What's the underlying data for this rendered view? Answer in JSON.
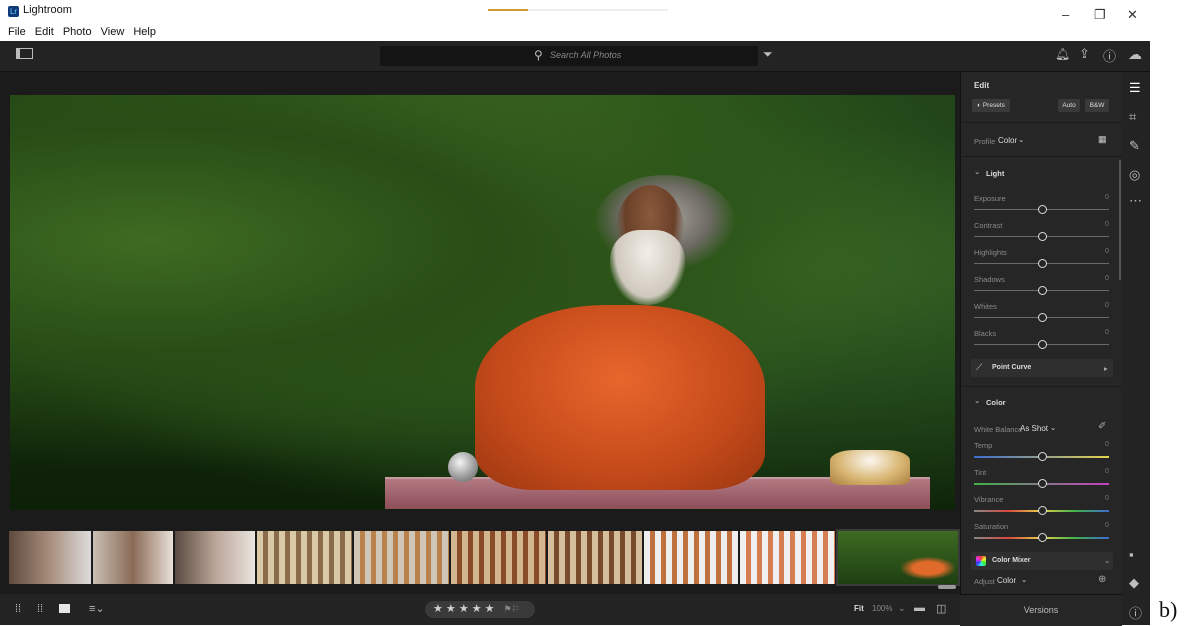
{
  "app": {
    "title": "Lightroom",
    "logo_text": "Lr"
  },
  "window_controls": {
    "minimize": "–",
    "restore": "❐",
    "close": "✕"
  },
  "loading_progress": 0.22,
  "menu": [
    "File",
    "Edit",
    "Photo",
    "View",
    "Help"
  ],
  "topbar": {
    "search_placeholder": "Search All Photos"
  },
  "edit_panel": {
    "title": "Edit",
    "presets_label": "Presets",
    "auto_label": "Auto",
    "bw_label": "B&W",
    "profile_label": "Profile",
    "profile_value": "Color",
    "light": {
      "title": "Light",
      "sliders": [
        {
          "label": "Exposure",
          "value": "0"
        },
        {
          "label": "Contrast",
          "value": "0"
        },
        {
          "label": "Highlights",
          "value": "0"
        },
        {
          "label": "Shadows",
          "value": "0"
        },
        {
          "label": "Whites",
          "value": "0"
        },
        {
          "label": "Blacks",
          "value": "0"
        }
      ]
    },
    "point_curve_label": "Point Curve",
    "color": {
      "title": "Color",
      "white_balance_label": "White Balance",
      "white_balance_value": "As Shot",
      "sliders": [
        {
          "label": "Temp",
          "value": "0"
        },
        {
          "label": "Tint",
          "value": "0"
        },
        {
          "label": "Vibrance",
          "value": "0"
        },
        {
          "label": "Saturation",
          "value": "0"
        }
      ]
    },
    "color_mixer_label": "Color Mixer",
    "adjust_label": "Adjust",
    "adjust_value": "Color"
  },
  "bottombar": {
    "stars": "★ ★ ★ ★ ★",
    "fit_label": "Fit",
    "zoom_label": "100%"
  },
  "versions_label": "Versions",
  "side_label": "b)"
}
